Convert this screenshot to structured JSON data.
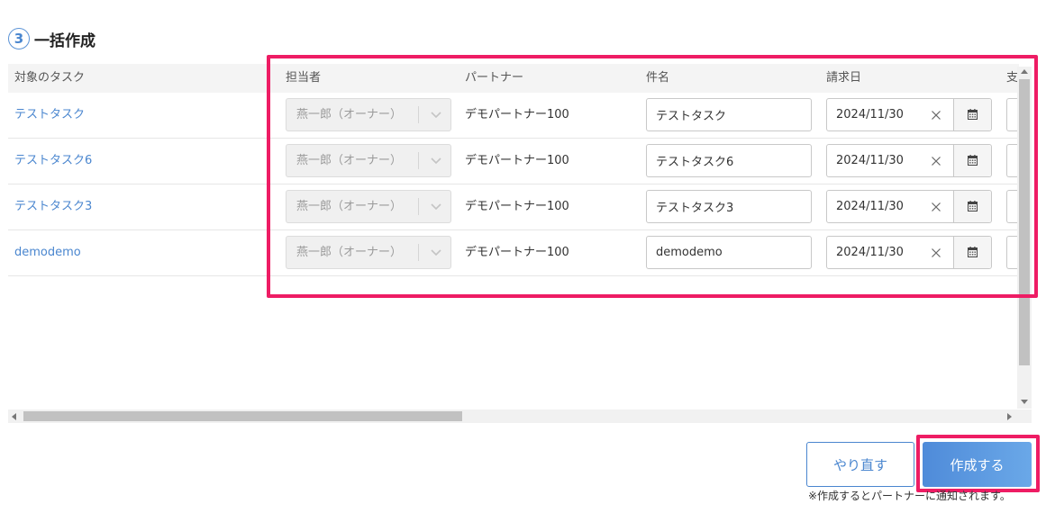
{
  "section": {
    "step": "3",
    "title": "一括作成"
  },
  "table": {
    "headers": {
      "task": "対象のタスク",
      "assignee": "担当者",
      "partner": "パートナー",
      "subject": "件名",
      "billing_date": "請求日",
      "next": "支"
    },
    "rows": [
      {
        "task": "テストタスク",
        "assignee": "燕一郎（オーナー）",
        "partner": "デモパートナー100",
        "subject": "テストタスク",
        "billing_date": "2024/11/30"
      },
      {
        "task": "テストタスク6",
        "assignee": "燕一郎（オーナー）",
        "partner": "デモパートナー100",
        "subject": "テストタスク6",
        "billing_date": "2024/11/30"
      },
      {
        "task": "テストタスク3",
        "assignee": "燕一郎（オーナー）",
        "partner": "デモパートナー100",
        "subject": "テストタスク3",
        "billing_date": "2024/11/30"
      },
      {
        "task": "demodemo",
        "assignee": "燕一郎（オーナー）",
        "partner": "デモパートナー100",
        "subject": "demodemo",
        "billing_date": "2024/11/30"
      }
    ]
  },
  "actions": {
    "redo_label": "やり直す",
    "create_label": "作成する",
    "note": "※作成するとパートナーに通知されます。"
  },
  "icons": {
    "chevron": "chevron-down-icon",
    "clear": "close-icon",
    "calendar": "calendar-icon"
  },
  "colors": {
    "accent": "#4a86cf",
    "highlight": "#ee1c64"
  }
}
